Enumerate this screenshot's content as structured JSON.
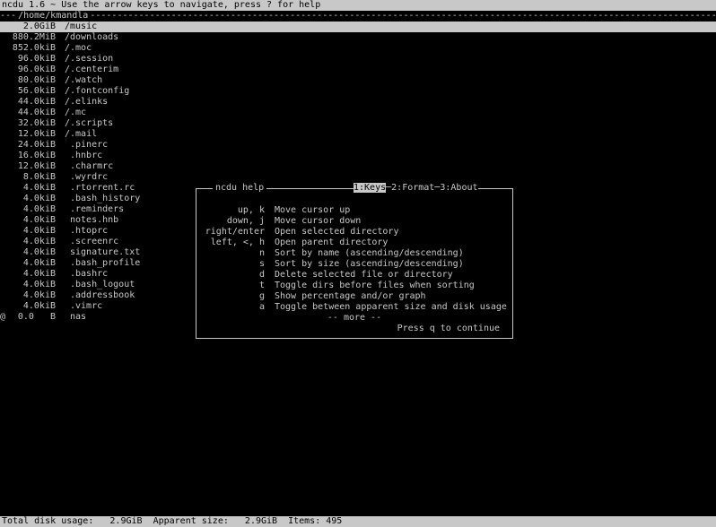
{
  "header": {
    "text": "ncdu 1.6 ~ Use the arrow keys to navigate, press ? for help"
  },
  "path": {
    "prefix": "---",
    "label": "/home/kmandla",
    "fill": "---------------------------------------------------------------------------------------------------------------------------------------------"
  },
  "entries": [
    {
      "flag": "",
      "size": "2.0GiB",
      "name": "/music",
      "dir": true,
      "selected": true
    },
    {
      "flag": "",
      "size": "880.2MiB",
      "name": "/downloads",
      "dir": true
    },
    {
      "flag": "",
      "size": "852.0kiB",
      "name": "/.moc",
      "dir": true
    },
    {
      "flag": "",
      "size": "96.0kiB",
      "name": "/.session",
      "dir": true
    },
    {
      "flag": "",
      "size": "96.0kiB",
      "name": "/.centerim",
      "dir": true
    },
    {
      "flag": "",
      "size": "80.0kiB",
      "name": "/.watch",
      "dir": true
    },
    {
      "flag": "",
      "size": "56.0kiB",
      "name": "/.fontconfig",
      "dir": true
    },
    {
      "flag": "",
      "size": "44.0kiB",
      "name": "/.elinks",
      "dir": true
    },
    {
      "flag": "",
      "size": "44.0kiB",
      "name": "/.mc",
      "dir": true
    },
    {
      "flag": "",
      "size": "32.0kiB",
      "name": "/.scripts",
      "dir": true
    },
    {
      "flag": "",
      "size": "12.0kiB",
      "name": "/.mail",
      "dir": true
    },
    {
      "flag": "",
      "size": "24.0kiB",
      "name": ".pinerc",
      "dir": false
    },
    {
      "flag": "",
      "size": "16.0kiB",
      "name": ".hnbrc",
      "dir": false
    },
    {
      "flag": "",
      "size": "12.0kiB",
      "name": ".charmrc",
      "dir": false
    },
    {
      "flag": "",
      "size": "8.0kiB",
      "name": ".wyrdrc",
      "dir": false
    },
    {
      "flag": "",
      "size": "4.0kiB",
      "name": ".rtorrent.rc",
      "dir": false
    },
    {
      "flag": "",
      "size": "4.0kiB",
      "name": ".bash_history",
      "dir": false
    },
    {
      "flag": "",
      "size": "4.0kiB",
      "name": ".reminders",
      "dir": false
    },
    {
      "flag": "",
      "size": "4.0kiB",
      "name": "notes.hnb",
      "dir": false
    },
    {
      "flag": "",
      "size": "4.0kiB",
      "name": ".htoprc",
      "dir": false
    },
    {
      "flag": "",
      "size": "4.0kiB",
      "name": ".screenrc",
      "dir": false
    },
    {
      "flag": "",
      "size": "4.0kiB",
      "name": "signature.txt",
      "dir": false
    },
    {
      "flag": "",
      "size": "4.0kiB",
      "name": ".bash_profile",
      "dir": false
    },
    {
      "flag": "",
      "size": "4.0kiB",
      "name": ".bashrc",
      "dir": false
    },
    {
      "flag": "",
      "size": "4.0kiB",
      "name": ".bash_logout",
      "dir": false
    },
    {
      "flag": "",
      "size": "4.0kiB",
      "name": ".addressbook",
      "dir": false
    },
    {
      "flag": "",
      "size": "4.0kiB",
      "name": ".vimrc",
      "dir": false
    },
    {
      "flag": "@",
      "size": "0.0   B",
      "name": "nas",
      "dir": false
    }
  ],
  "help": {
    "title": "ncdu help",
    "tabs": [
      {
        "label": "1:Keys",
        "active": true
      },
      {
        "label": "2:Format",
        "active": false
      },
      {
        "label": "3:About",
        "active": false
      }
    ],
    "keys": [
      {
        "key": "up, k",
        "desc": "Move cursor up"
      },
      {
        "key": "down, j",
        "desc": "Move cursor down"
      },
      {
        "key": "right/enter",
        "desc": "Open selected directory"
      },
      {
        "key": "left, <, h",
        "desc": "Open parent directory"
      },
      {
        "key": "n",
        "desc": "Sort by name (ascending/descending)"
      },
      {
        "key": "s",
        "desc": "Sort by size (ascending/descending)"
      },
      {
        "key": "d",
        "desc": "Delete selected file or directory"
      },
      {
        "key": "t",
        "desc": "Toggle dirs before files when sorting"
      },
      {
        "key": "g",
        "desc": "Show percentage and/or graph"
      },
      {
        "key": "a",
        "desc": "Toggle between apparent size and disk usage"
      }
    ],
    "more": "-- more --",
    "continue": "Press q to continue"
  },
  "status": {
    "text": "Total disk usage:   2.9GiB  Apparent size:   2.9GiB  Items: 495"
  },
  "colors": {
    "background": "#000000",
    "foreground": "#c8c8c8",
    "highlight": "#c8c8c8"
  }
}
